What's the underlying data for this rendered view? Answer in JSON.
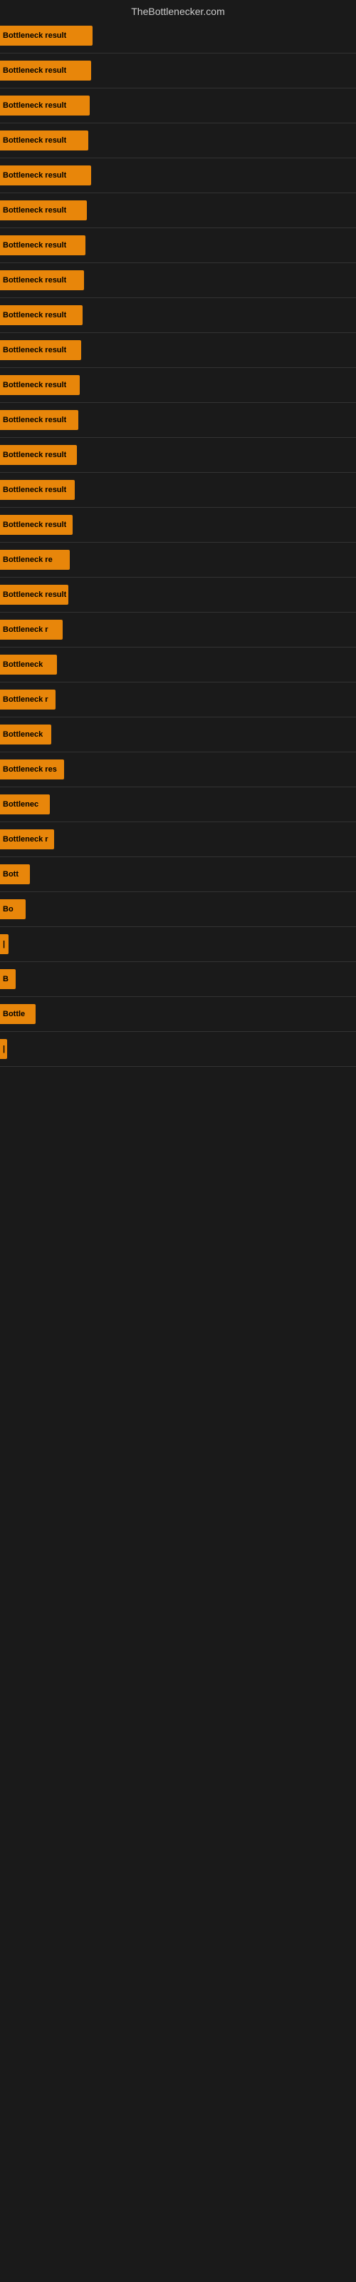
{
  "site": {
    "title": "TheBottlenecker.com"
  },
  "bars": [
    {
      "label": "Bottleneck result",
      "width": 130,
      "visible_text": "Bottleneck result"
    },
    {
      "label": "Bottleneck result",
      "width": 128,
      "visible_text": "Bottleneck result"
    },
    {
      "label": "Bottleneck result",
      "width": 126,
      "visible_text": "Bottleneck result"
    },
    {
      "label": "Bottleneck result",
      "width": 124,
      "visible_text": "Bottleneck result"
    },
    {
      "label": "Bottleneck result",
      "width": 128,
      "visible_text": "Bottleneck result"
    },
    {
      "label": "Bottleneck result",
      "width": 122,
      "visible_text": "Bottleneck result"
    },
    {
      "label": "Bottleneck result",
      "width": 120,
      "visible_text": "Bottleneck result"
    },
    {
      "label": "Bottleneck result",
      "width": 118,
      "visible_text": "Bottleneck result"
    },
    {
      "label": "Bottleneck result",
      "width": 116,
      "visible_text": "Bottleneck result"
    },
    {
      "label": "Bottleneck result",
      "width": 114,
      "visible_text": "Bottleneck result"
    },
    {
      "label": "Bottleneck result",
      "width": 112,
      "visible_text": "Bottleneck result"
    },
    {
      "label": "Bottleneck result",
      "width": 110,
      "visible_text": "Bottleneck result"
    },
    {
      "label": "Bottleneck result",
      "width": 108,
      "visible_text": "Bottleneck result"
    },
    {
      "label": "Bottleneck result",
      "width": 105,
      "visible_text": "Bottleneck result"
    },
    {
      "label": "Bottleneck result",
      "width": 102,
      "visible_text": "Bottleneck result"
    },
    {
      "label": "Bottleneck result",
      "width": 98,
      "visible_text": "Bottleneck re"
    },
    {
      "label": "Bottleneck result",
      "width": 96,
      "visible_text": "Bottleneck result"
    },
    {
      "label": "Bottleneck result",
      "width": 88,
      "visible_text": "Bottleneck r"
    },
    {
      "label": "Bottleneck result",
      "width": 80,
      "visible_text": "Bottleneck"
    },
    {
      "label": "Bottleneck result",
      "width": 78,
      "visible_text": "Bottleneck r"
    },
    {
      "label": "Bottleneck result",
      "width": 72,
      "visible_text": "Bottleneck"
    },
    {
      "label": "Bottleneck result",
      "width": 90,
      "visible_text": "Bottleneck res"
    },
    {
      "label": "Bottleneck result",
      "width": 70,
      "visible_text": "Bottlenec"
    },
    {
      "label": "Bottleneck result",
      "width": 76,
      "visible_text": "Bottleneck r"
    },
    {
      "label": "Bottleneck result",
      "width": 42,
      "visible_text": "Bott"
    },
    {
      "label": "Bottleneck result",
      "width": 36,
      "visible_text": "Bo"
    },
    {
      "label": "Bottleneck result",
      "width": 12,
      "visible_text": "|"
    },
    {
      "label": "Bottleneck result",
      "width": 22,
      "visible_text": "B"
    },
    {
      "label": "Bottleneck result",
      "width": 50,
      "visible_text": "Bottle"
    },
    {
      "label": "Bottleneck result",
      "width": 10,
      "visible_text": "|"
    }
  ]
}
